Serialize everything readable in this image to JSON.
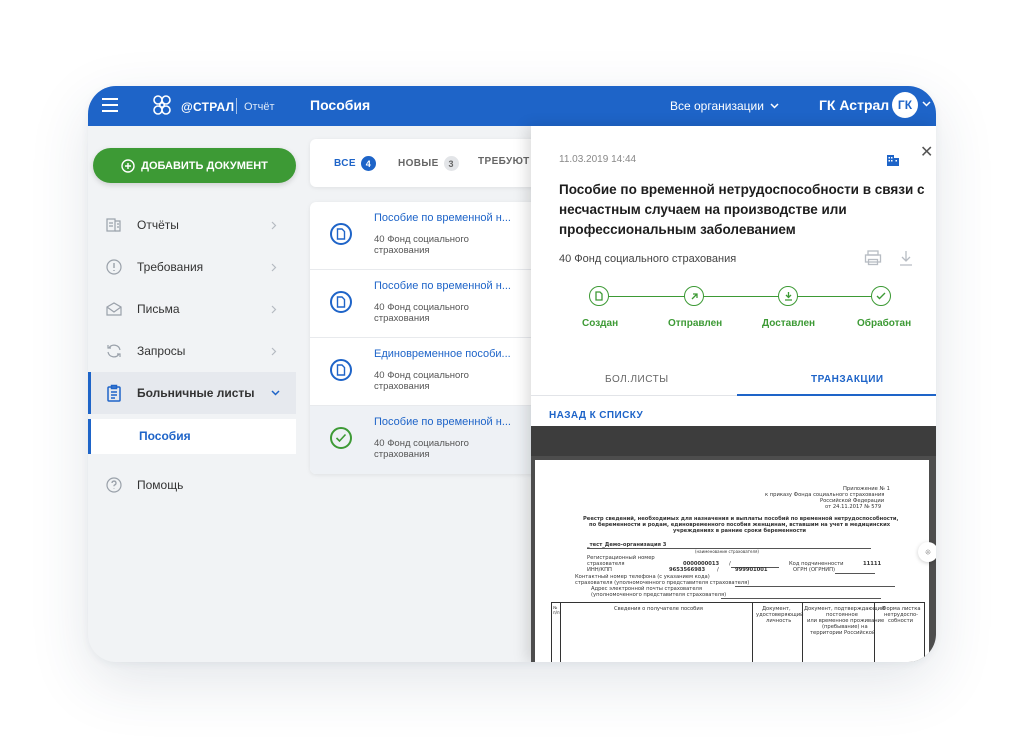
{
  "topbar": {
    "logo_text": "@СТРАЛ",
    "logo_sub": "Отчёт",
    "page_title": "Пособия",
    "org_select": "Все организации",
    "user_name": "ГК Астрал",
    "avatar": "ГК",
    "brand_color": "#1e64c8"
  },
  "sidebar": {
    "add_button": "ДОБАВИТЬ ДОКУМЕНТ",
    "add_button_color": "#3d9a35",
    "items": [
      {
        "label": "Отчёты",
        "icon": "report-icon"
      },
      {
        "label": "Требования",
        "icon": "alert-circle-icon"
      },
      {
        "label": "Письма",
        "icon": "envelope-icon"
      },
      {
        "label": "Запросы",
        "icon": "refresh-icon"
      },
      {
        "label": "Больничные листы",
        "icon": "clipboard-icon"
      },
      {
        "label": "Помощь",
        "icon": "help-icon"
      }
    ],
    "sub_item": "Пособия"
  },
  "filters": {
    "all": {
      "label": "ВСЕ",
      "count": "4"
    },
    "new": {
      "label": "НОВЫЕ",
      "count": "3"
    },
    "req": {
      "label": "ТРЕБУЮТ У"
    }
  },
  "list": [
    {
      "title": "Пособие по временной н...",
      "sub": "40 Фонд социального страхования",
      "status": "document"
    },
    {
      "title": "Пособие по временной н...",
      "sub": "40 Фонд социального страхования",
      "status": "document"
    },
    {
      "title": "Единовременное пособи...",
      "sub": "40 Фонд социального страхования",
      "status": "document"
    },
    {
      "title": "Пособие по временной н...",
      "sub": "40 Фонд социального страхования",
      "status": "done"
    }
  ],
  "panel": {
    "date": "11.03.2019 14:44",
    "title": "Пособие по временной нетрудоспособности в связи с несчастным случаем на производстве или профессиональным заболеванием",
    "org": "40 Фонд социального страхования",
    "steps": [
      "Создан",
      "Отправлен",
      "Доставлен",
      "Обработан"
    ],
    "tabs": [
      "БОЛ.ЛИСТЫ",
      "ТРАНЗАКЦИИ"
    ],
    "back": "НАЗАД К СПИСКУ"
  },
  "doc": {
    "app1": "Приложение № 1",
    "app2": "к приказу Фонда социального страхования",
    "app3": "Российской Федерации",
    "app4": "от 24.11.2017 № 579",
    "h1": "Реестр сведений, необходимых для назначения и выплаты пособий по временной нетрудоспособности,",
    "h2": "по беременности и родам, единовременного пособия женщинам, вставшим на учет в медицинских",
    "h3": "учреждениях в ранние сроки беременности",
    "org": "_тест_Демо-организация 3",
    "org_cap": "(наименование страхователя)",
    "reg1": "Регистрационный номер",
    "reg2": "страхователя",
    "reg_val": "0000000013",
    "slash": "/",
    "sub_code_lbl": "Код подчиненности",
    "sub_code": "11111",
    "inn_lbl": "ИНН/КПП",
    "inn": "9653566983",
    "kpp": "999901001",
    "ogrn_lbl": "ОГРН (ОГРНИП)",
    "phone1": "Контактный номер телефона (с указанием кода)",
    "phone2": "страхователя (уполномоченного представителя страхователя)",
    "mail1": "Адрес электронной почты страхователя",
    "mail2": "(уполномоченного представителя страхователя)",
    "col_n": "№",
    "col_np": "п/п",
    "col1": "Сведения о получателе пособия",
    "col2a": "Документ,",
    "col2b": "удостоверяющий",
    "col2c": "личность",
    "col3a": "Документ, подтверждающий",
    "col3b": "постоянное",
    "col3c": "или временное проживание",
    "col3d": "(пребывание) на",
    "col3e": "территории Российской",
    "col4a": "Форма листка",
    "col4b": "нетрудоспо-",
    "col4c": "собности"
  }
}
